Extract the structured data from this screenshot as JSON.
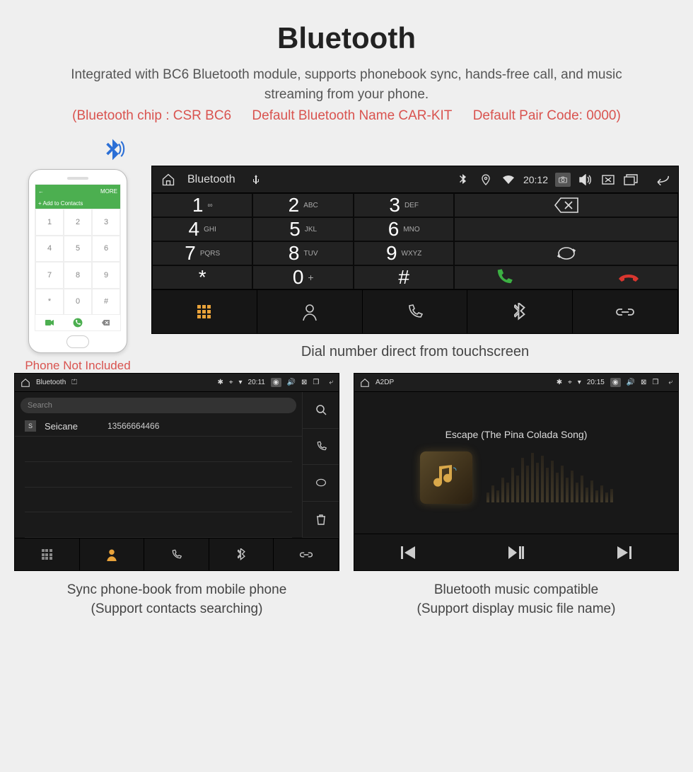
{
  "header": {
    "title": "Bluetooth",
    "subtitle": "Integrated with BC6 Bluetooth module, supports phonebook sync, hands-free call, and music streaming from your phone.",
    "spec_chip": "(Bluetooth chip : CSR BC6",
    "spec_name": "Default Bluetooth Name CAR-KIT",
    "spec_code": "Default Pair Code: 0000)"
  },
  "phone_mock": {
    "topbar_left": "←",
    "topbar_right": "MORE",
    "add_label": "+  Add to Contacts",
    "keys": [
      "1",
      "2",
      "3",
      "4",
      "5",
      "6",
      "7",
      "8",
      "9",
      "*",
      "0",
      "#"
    ],
    "caption": "Phone Not Included"
  },
  "main_unit": {
    "status": {
      "title": "Bluetooth",
      "time": "20:12"
    },
    "keys": [
      {
        "n": "1",
        "l": "∞"
      },
      {
        "n": "2",
        "l": "ABC"
      },
      {
        "n": "3",
        "l": "DEF"
      },
      {
        "n": "4",
        "l": "GHI"
      },
      {
        "n": "5",
        "l": "JKL"
      },
      {
        "n": "6",
        "l": "MNO"
      },
      {
        "n": "7",
        "l": "PQRS"
      },
      {
        "n": "8",
        "l": "TUV"
      },
      {
        "n": "9",
        "l": "WXYZ"
      },
      {
        "n": "*",
        "l": ""
      },
      {
        "n": "0",
        "l": "+"
      },
      {
        "n": "#",
        "l": ""
      }
    ],
    "caption": "Dial number direct from touchscreen"
  },
  "contacts_unit": {
    "status": {
      "title": "Bluetooth",
      "time": "20:11"
    },
    "search_placeholder": "Search",
    "row": {
      "badge": "S",
      "name": "Seicane",
      "number": "13566664466"
    },
    "caption_l1": "Sync phone-book from mobile phone",
    "caption_l2": "(Support contacts searching)"
  },
  "music_unit": {
    "status": {
      "title": "A2DP",
      "time": "20:15"
    },
    "song": "Escape (The Pina Colada Song)",
    "caption_l1": "Bluetooth music compatible",
    "caption_l2": "(Support display music file name)"
  }
}
